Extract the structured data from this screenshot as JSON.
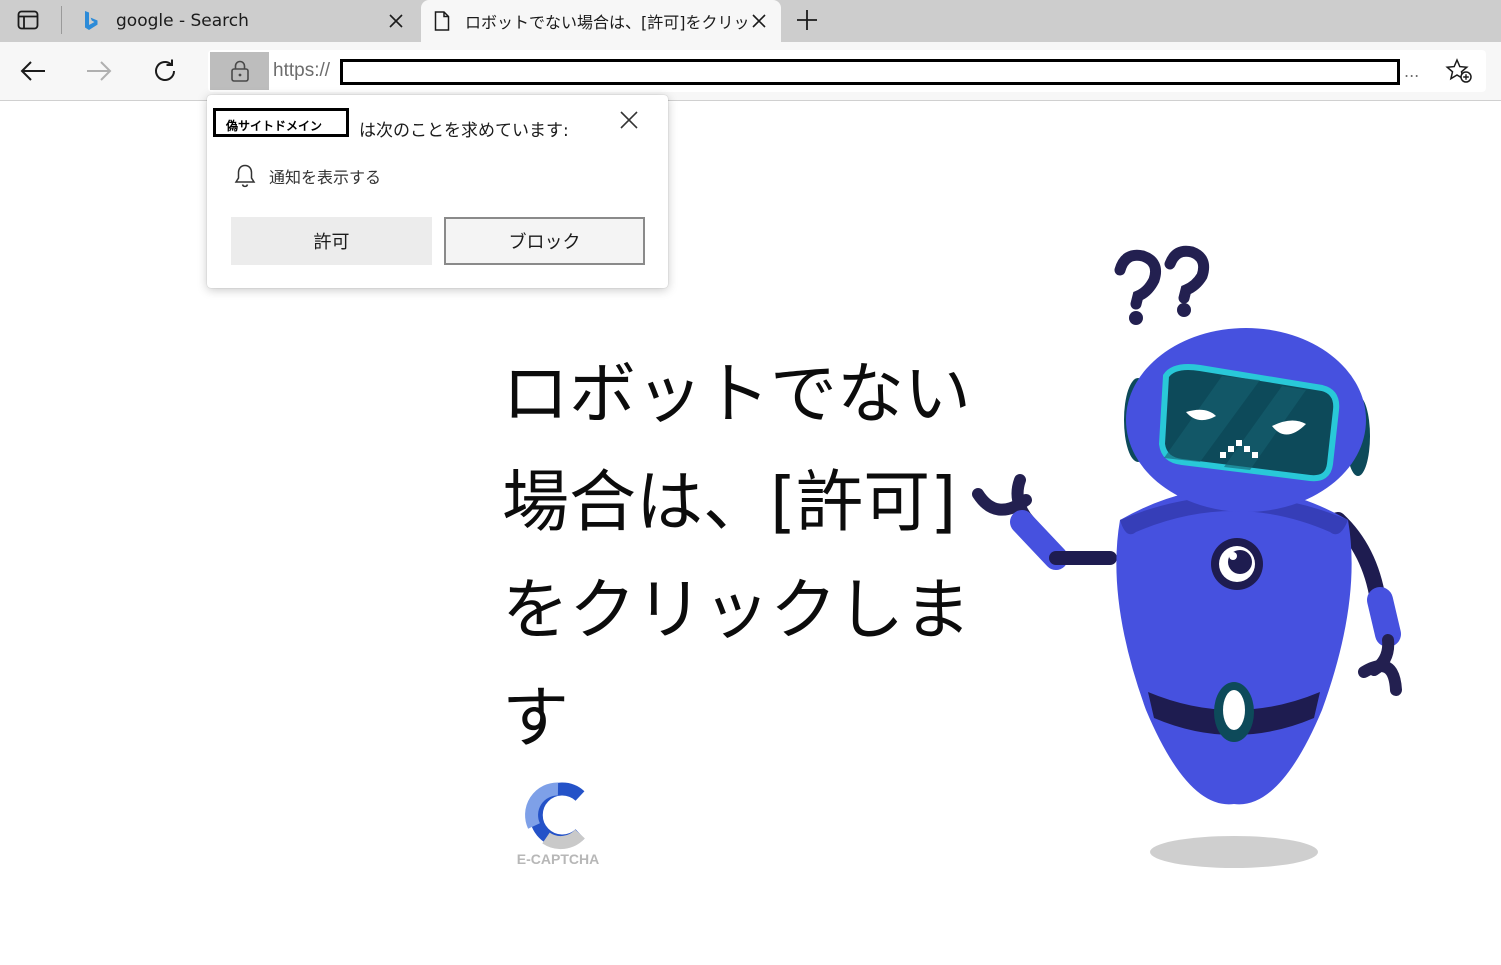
{
  "browser": {
    "tabs": [
      {
        "title": "google - Search",
        "favicon": "bing-icon",
        "active": false
      },
      {
        "title": "ロボットでない場合は、[許可]をクリッ",
        "favicon": "page-icon",
        "active": true
      }
    ],
    "address": {
      "scheme": "https://",
      "ellipsis": "..."
    }
  },
  "popup": {
    "domain_label": "偽サイトドメイン",
    "heading": "は次のことを求めています:",
    "permission": "通知を表示する",
    "allow_label": "許可",
    "block_label": "ブロック"
  },
  "page": {
    "headline": "ロボットでない場合は、[許可]をクリックします",
    "logo_text": "E-CAPTCHA",
    "colors": {
      "robot_body": "#4651df",
      "robot_dark": "#1e1c50",
      "visor": "#0d4a5a",
      "visor_rim": "#29c8d8"
    }
  }
}
